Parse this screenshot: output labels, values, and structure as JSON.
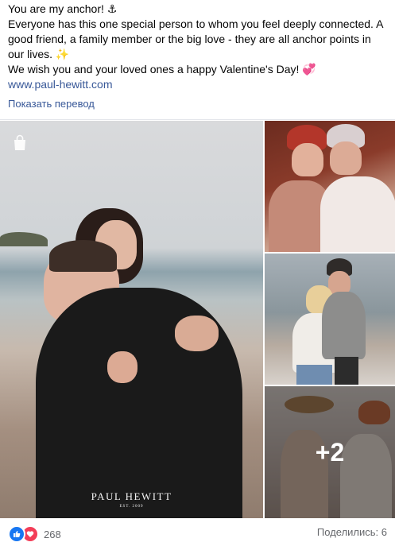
{
  "post": {
    "line1": "You are my anchor! ⚓",
    "line2": "Everyone has this one special person to whom you feel deeply connected. A good friend, a family member or the big love - they are all anchor points in our lives. ✨",
    "line3": "We wish you and your loved ones a happy Valentine's Day! 💞",
    "link": "www.paul-hewitt.com",
    "translate": "Показать перевод"
  },
  "gallery": {
    "watermark": "PAUL HEWITT",
    "watermark_sub": "EST. 2009",
    "more_count": "+2"
  },
  "footer": {
    "reaction_count": "268",
    "shares": "Поделились: 6"
  },
  "colors": {
    "link": "#385898",
    "like": "#1877f2",
    "love": "#f33e58"
  }
}
